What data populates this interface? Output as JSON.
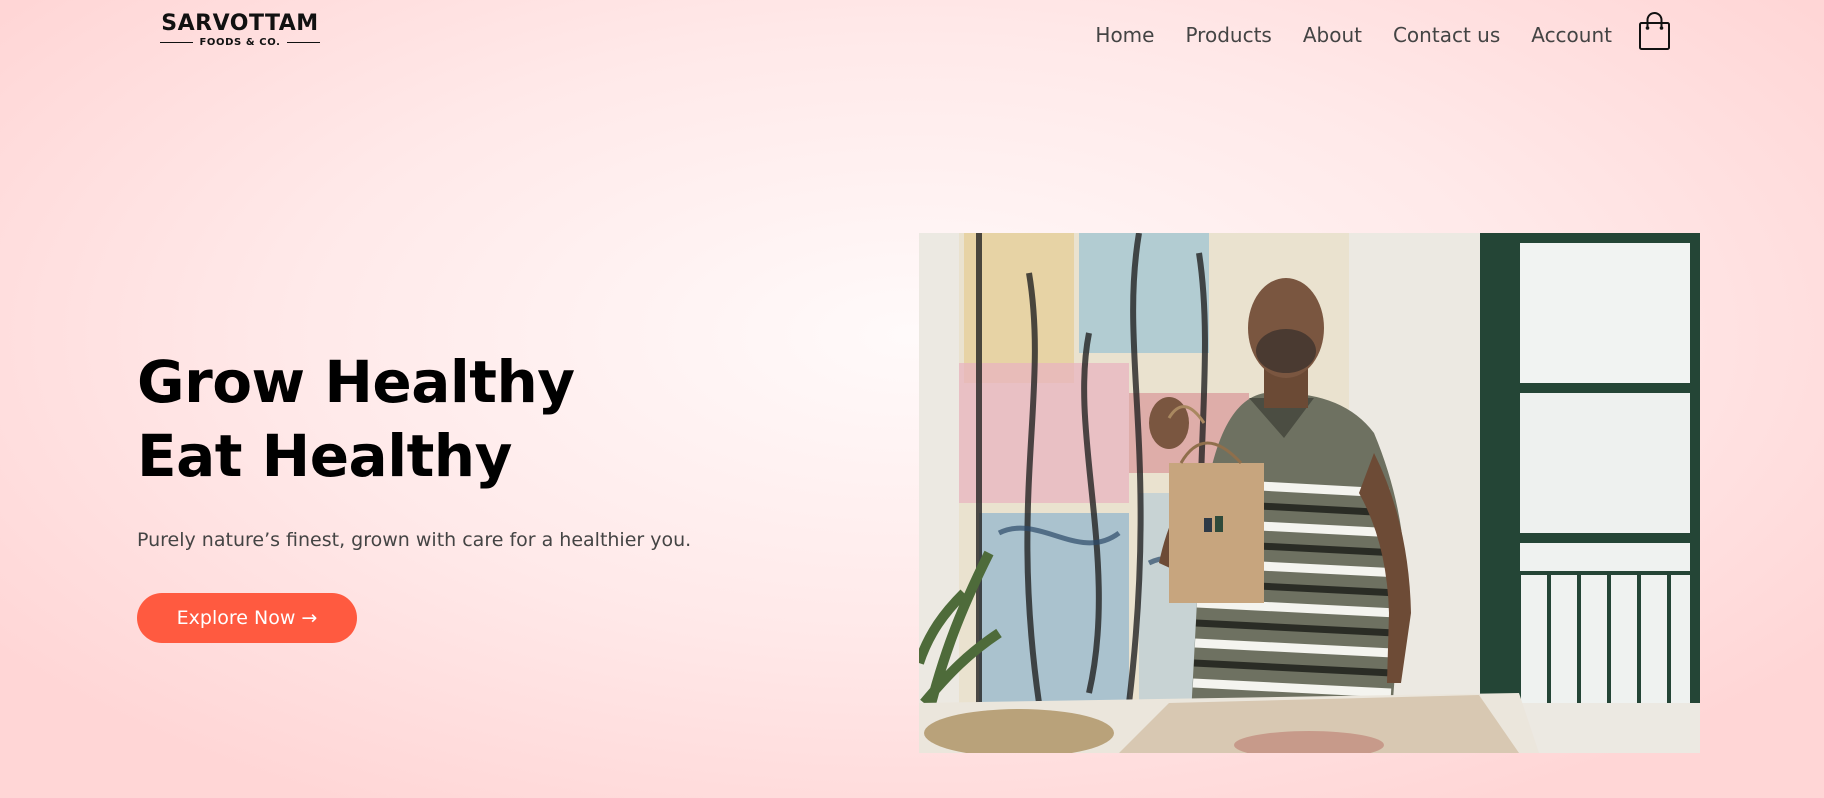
{
  "brand": {
    "name": "SARVOTTAM",
    "tagline": "FOODS & CO."
  },
  "nav": {
    "items": [
      {
        "label": "Home"
      },
      {
        "label": "Products"
      },
      {
        "label": "About"
      },
      {
        "label": "Contact us"
      },
      {
        "label": "Account"
      }
    ],
    "cart_icon": "shopping-bag-icon"
  },
  "hero": {
    "title_line1": "Grow Healthy",
    "title_line2": "Eat Healthy",
    "subtitle": "Purely nature’s finest, grown with care for a healthier you.",
    "cta_label": "Explore Now →",
    "image_subject": "man-holding-paper-bag-photo"
  },
  "colors": {
    "accent": "#ff5a40",
    "background": "#ffe3e3",
    "heading": "#000000",
    "nav_text": "#444444"
  }
}
